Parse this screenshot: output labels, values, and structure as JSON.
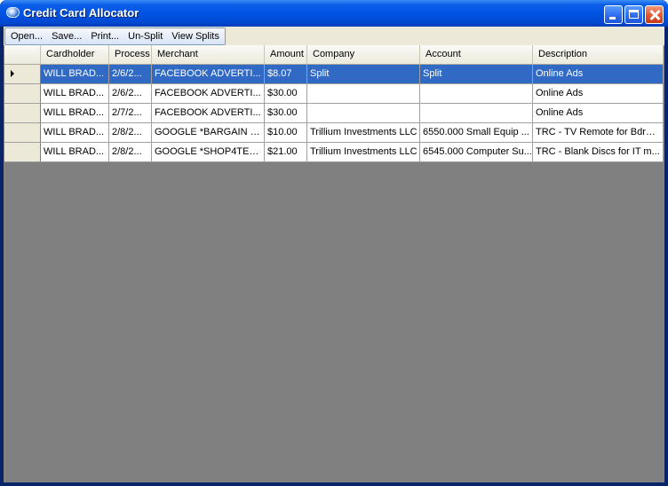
{
  "window": {
    "title": "Credit Card Allocator"
  },
  "menu": [
    "Open...",
    "Save...",
    "Print...",
    "Un-Split",
    "View Splits"
  ],
  "columns": [
    "Cardholder",
    "Process",
    "Merchant",
    "Amount",
    "Company",
    "Account",
    "Description"
  ],
  "rows": [
    {
      "cardholder": "WILL BRAD...",
      "process": "2/6/2...",
      "merchant": "FACEBOOK ADVERTI...",
      "amount": "$8.07",
      "company": "Split",
      "account": "Split",
      "description": "Online Ads",
      "selected": true
    },
    {
      "cardholder": "WILL BRAD...",
      "process": "2/6/2...",
      "merchant": "FACEBOOK ADVERTI...",
      "amount": "$30.00",
      "company": "",
      "account": "",
      "description": "Online Ads",
      "selected": false
    },
    {
      "cardholder": "WILL BRAD...",
      "process": "2/7/2...",
      "merchant": "FACEBOOK ADVERTI...",
      "amount": "$30.00",
      "company": "",
      "account": "",
      "description": "Online Ads",
      "selected": false
    },
    {
      "cardholder": "WILL BRAD...",
      "process": "2/8/2...",
      "merchant": "GOOGLE *BARGAIN S...",
      "amount": "$10.00",
      "company": "Trillium Investments LLC",
      "account": "6550.000 Small Equip ...",
      "description": "TRC - TV Remote for Bdrm ...",
      "selected": false
    },
    {
      "cardholder": "WILL BRAD...",
      "process": "2/8/2...",
      "merchant": "GOOGLE *SHOP4TEC...",
      "amount": "$21.00",
      "company": "Trillium Investments LLC",
      "account": "6545.000 Computer Su...",
      "description": "TRC -  Blank Discs for IT m...",
      "selected": false
    }
  ],
  "colors": {
    "selection": "#316ac5",
    "titlebar": "#0054e3",
    "empty_area": "#808080"
  }
}
